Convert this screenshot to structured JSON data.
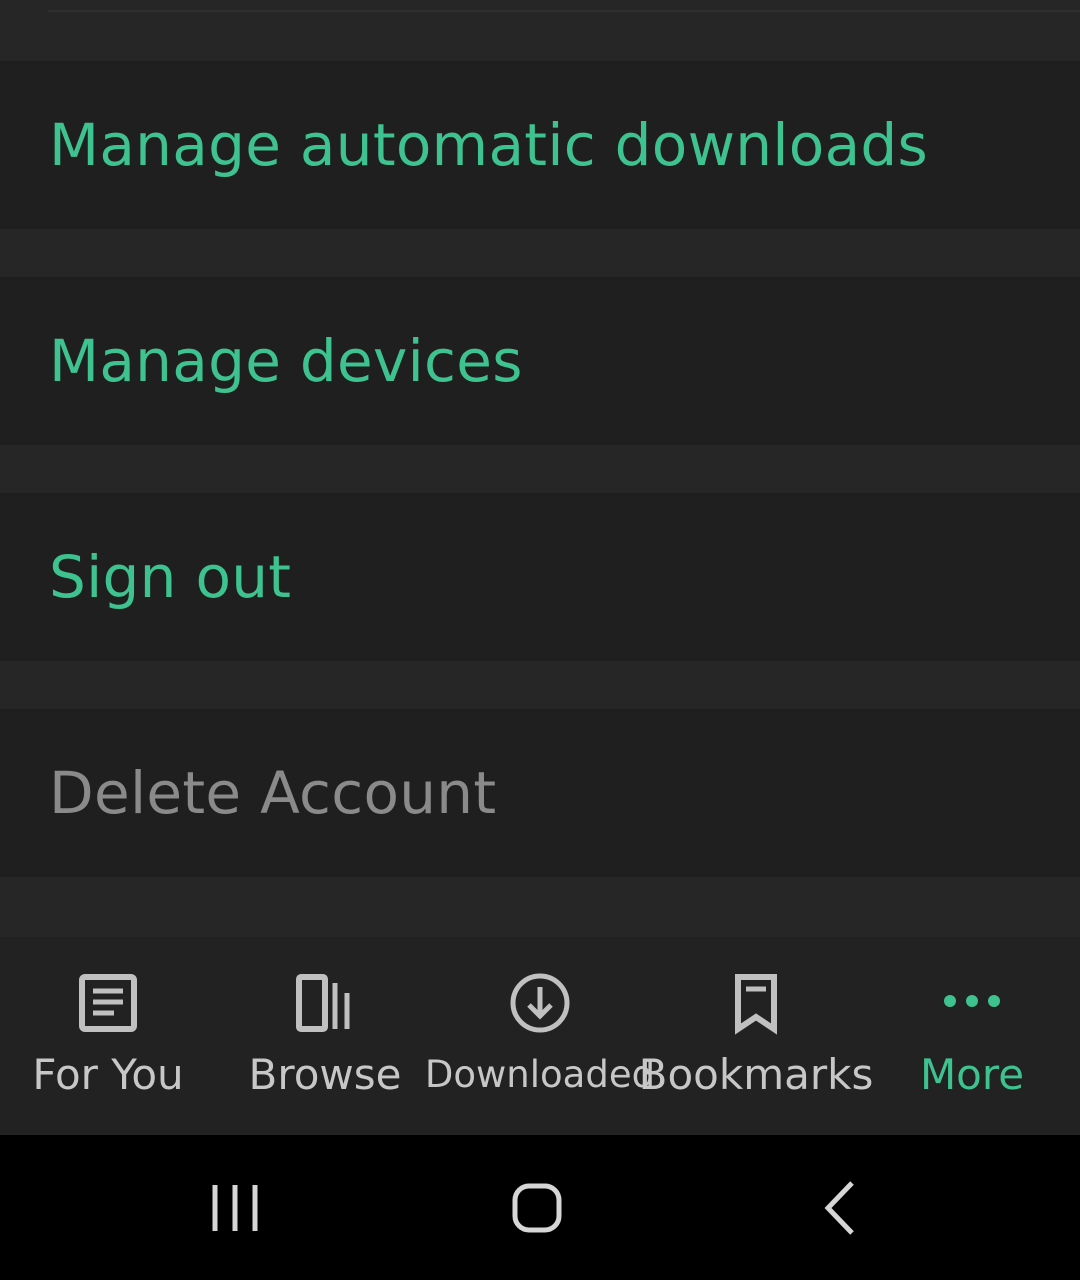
{
  "colors": {
    "accent": "#3ec28f",
    "muted_text": "#8a8a8a",
    "nav_text": "#c7c7c7",
    "nav_icon": "#c0c0c0",
    "system_icon": "#d6d6d6"
  },
  "menu": {
    "items": [
      {
        "label": "Manage automatic downloads",
        "style": "accent"
      },
      {
        "label": "Manage devices",
        "style": "accent"
      },
      {
        "label": "Sign out",
        "style": "accent"
      },
      {
        "label": "Delete Account",
        "style": "muted"
      }
    ]
  },
  "bottom_nav": {
    "items": [
      {
        "label": "For You",
        "icon": "article-icon",
        "active": false
      },
      {
        "label": "Browse",
        "icon": "library-icon",
        "active": false
      },
      {
        "label": "Downloaded",
        "icon": "download-circle-icon",
        "active": false
      },
      {
        "label": "Bookmarks",
        "icon": "bookmark-icon",
        "active": false
      },
      {
        "label": "More",
        "icon": "more-dots-icon",
        "active": true
      }
    ]
  },
  "system_nav": {
    "buttons": [
      "recent-apps-icon",
      "home-icon",
      "back-icon"
    ]
  }
}
